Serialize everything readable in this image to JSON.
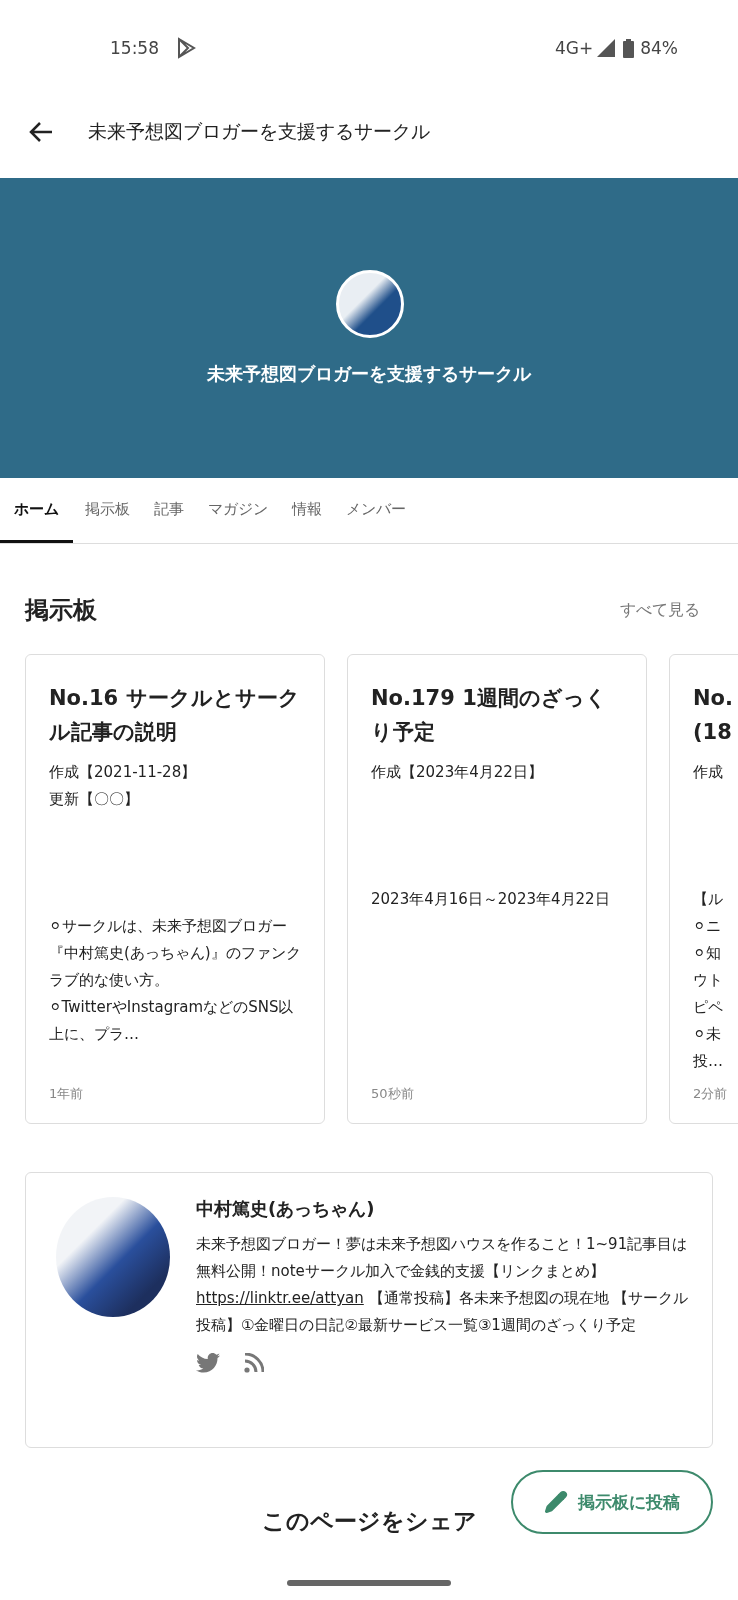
{
  "status_bar": {
    "time": "15:58",
    "network": "4G+",
    "battery": "84%"
  },
  "app_bar": {
    "title": "未来予想図ブロガーを支援するサークル"
  },
  "banner": {
    "circle_name": "未来予想図ブロガーを支援するサークル"
  },
  "tabs": [
    {
      "label": "ホーム",
      "selected": true
    },
    {
      "label": "掲示板",
      "selected": false
    },
    {
      "label": "記事",
      "selected": false
    },
    {
      "label": "マガジン",
      "selected": false
    },
    {
      "label": "情報",
      "selected": false
    },
    {
      "label": "メンバー",
      "selected": false
    }
  ],
  "board": {
    "heading": "掲示板",
    "see_all": "すべて見る",
    "posts": [
      {
        "title": "No.16 サークルとサークル記事の説明",
        "meta": [
          "作成【2021-11-28】",
          "更新【〇〇】"
        ],
        "excerpt": [
          "⚪サークルは、未来予想図ブロガー『中村篤史(あっちゃん)』のファンクラブ的な使い方。",
          "⚪TwitterやInstagramなどのSNS以上に、プラ…"
        ],
        "time": "1年前"
      },
      {
        "title": "No.179 1週間のざっくり予定",
        "meta": [
          "作成【2023年4月22日】"
        ],
        "excerpt": [
          "2023年4月16日～2023年4月22日"
        ],
        "time": "50秒前"
      },
      {
        "title": "No.",
        "title_line_2": "(18",
        "meta": [
          "作成"
        ],
        "excerpt": [
          "【ル",
          "⚪ニ",
          "⚪知",
          "ウト",
          "ピペ",
          "⚪未",
          "投…"
        ],
        "time": "2分前"
      }
    ]
  },
  "profile": {
    "name": "中村篤史(あっちゃん)",
    "bio_before_link": "未来予想図ブロガー！夢は未来予想図ハウスを作ること！1~91記事目は無料公開！noteサークル加入で金銭的支援【リンクまとめ】",
    "link": "https://linktr.ee/attyan",
    "bio_after_link": " 【通常投稿】各未来予想図の現在地 【サークル投稿】①金曜日の日記②最新サービス一覧③1週間のざっくり予定"
  },
  "share": {
    "heading": "このページをシェア"
  },
  "fab": {
    "label": "掲示板に投稿"
  }
}
